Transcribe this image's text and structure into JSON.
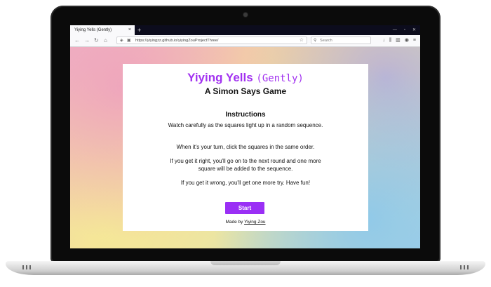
{
  "browser": {
    "tab_title": "Yiying Yells (Gently)",
    "tab_close": "×",
    "new_tab": "+",
    "window_controls": [
      "—",
      "▫",
      "✕"
    ],
    "url": "https://yiyingzz.github.io/yiyingZouProjectThree/",
    "search_placeholder": "Search"
  },
  "page": {
    "title_main": "Yiying Yells",
    "title_paren": "(Gently)",
    "subtitle": "A Simon Says Game",
    "instructions_heading": "Instructions",
    "paragraphs": [
      "Watch carefully as the squares light up in a random sequence.",
      "When it's your turn, click the squares in the same order.",
      "If you get it right, you'll go on to the next round and one more square will be added to the sequence.",
      "If you get it wrong, you'll get one more try. Have fun!"
    ],
    "start_label": "Start",
    "credit_prefix": "Made by",
    "credit_name": "Yiying Zou"
  },
  "colors": {
    "accent": "#9a2ff5",
    "title": "#a232f0"
  },
  "icons": [
    "back-icon",
    "forward-icon",
    "reload-icon",
    "home-icon",
    "shield-icon",
    "lock-icon",
    "star-icon",
    "search-icon",
    "library-icon",
    "sidebar-icon",
    "account-icon",
    "menu-icon"
  ]
}
